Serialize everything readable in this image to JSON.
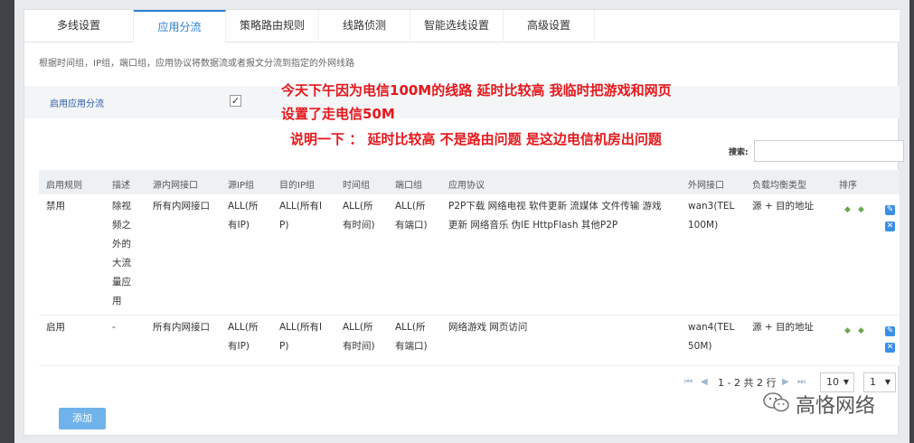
{
  "tabs": [
    "多线设置",
    "应用分流",
    "策略路由规则",
    "线路侦测",
    "智能选线设置",
    "高级设置"
  ],
  "description": "根据时间组，IP组，端口组，应用协议将数据流或者报文分流到指定的外网线路",
  "enable": {
    "label": "启用应用分流",
    "checked": true
  },
  "notes": [
    "今天下午因为电信100M的线路 延时比较高  我临时把游戏和网页",
    "设置了走电信50M",
    "说明一下 ：  延时比较高 不是路由问题  是这边电信机房出问题"
  ],
  "search": {
    "label": "搜索:",
    "value": ""
  },
  "table": {
    "headers": [
      "启用规则",
      "描述",
      "源内网接口",
      "源IP组",
      "目的IP组",
      "时间组",
      "端口组",
      "应用协议",
      "外网接口",
      "负载均衡类型",
      "排序",
      ""
    ],
    "rows": [
      {
        "status": "禁用",
        "desc": "除视\n频之\n外的\n大流\n量应\n用",
        "src_if": "所有内网接口",
        "src_ip": "ALL(所\n有IP)",
        "dst_ip": "ALL(所有I\nP)",
        "time": "ALL(所\n有时间)",
        "port": "ALL(所\n有端口)",
        "app": "P2P下载 网络电视 软件更新 流媒体 文件传输 游戏\n更新 网络音乐 伪IE HttpFlash 其他P2P",
        "wan": "wan3(TEL\n100M)",
        "lb": "源 + 目的地址"
      },
      {
        "status": "启用",
        "desc": "-",
        "src_if": "所有内网接口",
        "src_ip": "ALL(所\n有IP)",
        "dst_ip": "ALL(所有I\nP)",
        "time": "ALL(所\n有时间)",
        "port": "ALL(所\n有端口)",
        "app": "网络游戏 网页访问",
        "wan": "wan4(TEL\n50M)",
        "lb": "源 + 目的地址"
      }
    ]
  },
  "pagination": {
    "info": "1 - 2 共 2 行",
    "page_size": "10",
    "page": "1"
  },
  "add_button": "添加",
  "watermark": "高恪网络"
}
